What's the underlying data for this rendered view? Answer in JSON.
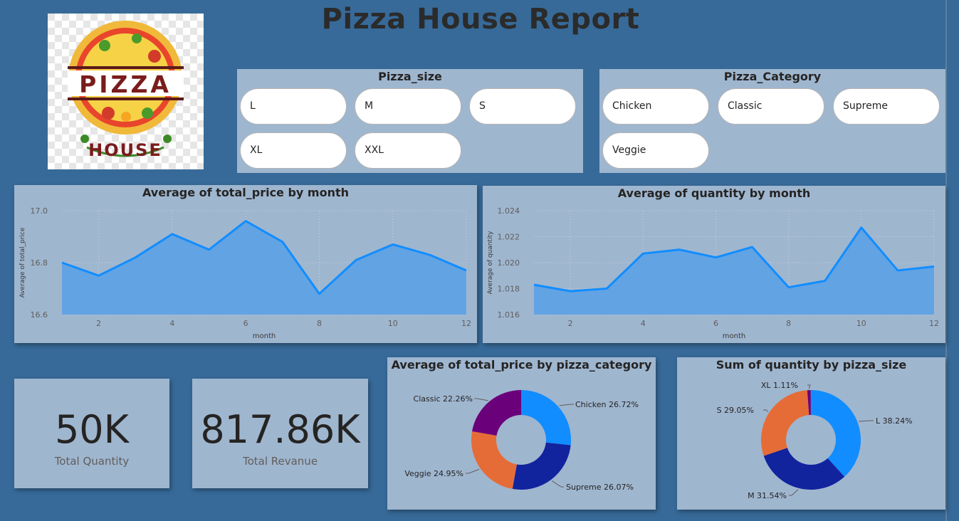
{
  "report": {
    "title": "Pizza House Report"
  },
  "logo": {
    "top_word": "PIZZA",
    "bottom_word": "HOUSE"
  },
  "slicers": {
    "size": {
      "title": "Pizza_size",
      "options": [
        "L",
        "M",
        "S",
        "XL",
        "XXL"
      ]
    },
    "category": {
      "title": "Pizza_Category",
      "options": [
        "Chicken",
        "Classic",
        "Supreme",
        "Veggie"
      ]
    }
  },
  "kpis": {
    "quantity": {
      "value": "50K",
      "label": "Total Quantity"
    },
    "revenue": {
      "value": "817.86K",
      "label": "Total Revanue"
    }
  },
  "colors": {
    "background": "#376a99",
    "panel": "#9fb6cf",
    "line": "#118dff",
    "area": "#62a3e4",
    "pie_blue": "#118dff",
    "pie_navy": "#12239e",
    "pie_orange": "#e66c37",
    "pie_purple": "#6b007b"
  },
  "chart_data": [
    {
      "type": "area",
      "title": "Average of total_price by month",
      "xlabel": "month",
      "ylabel": "Average of total_price",
      "x": [
        1,
        2,
        3,
        4,
        5,
        6,
        7,
        8,
        9,
        10,
        11,
        12
      ],
      "y": [
        16.8,
        16.75,
        16.82,
        16.91,
        16.85,
        16.96,
        16.88,
        16.68,
        16.81,
        16.87,
        16.83,
        16.77
      ],
      "ylim": [
        16.6,
        17.0
      ],
      "yticks": [
        "16.6",
        "16.8",
        "17.0"
      ],
      "xticks": [
        "2",
        "4",
        "6",
        "8",
        "10",
        "12"
      ],
      "grid": true
    },
    {
      "type": "area",
      "title": "Average of quantity by month",
      "xlabel": "month",
      "ylabel": "Average of quantity",
      "x": [
        1,
        2,
        3,
        4,
        5,
        6,
        7,
        8,
        9,
        10,
        11,
        12
      ],
      "y": [
        1.0183,
        1.0178,
        1.018,
        1.0207,
        1.021,
        1.0204,
        1.0212,
        1.0181,
        1.0186,
        1.0227,
        1.0194,
        1.0197
      ],
      "ylim": [
        1.016,
        1.024
      ],
      "yticks": [
        "1.016",
        "1.018",
        "1.020",
        "1.022",
        "1.024"
      ],
      "xticks": [
        "2",
        "4",
        "6",
        "8",
        "10",
        "12"
      ],
      "grid": true
    },
    {
      "type": "pie",
      "title": "Average of total_price by pizza_category",
      "slices": [
        {
          "label": "Chicken",
          "percent": 26.72,
          "text": "Chicken 26.72%",
          "color": "#118dff"
        },
        {
          "label": "Supreme",
          "percent": 26.07,
          "text": "Supreme 26.07%",
          "color": "#12239e"
        },
        {
          "label": "Veggie",
          "percent": 24.95,
          "text": "Veggie 24.95%",
          "color": "#e66c37"
        },
        {
          "label": "Classic",
          "percent": 22.26,
          "text": "Classic 22.26%",
          "color": "#6b007b"
        }
      ]
    },
    {
      "type": "pie",
      "title": "Sum of quantity by pizza_size",
      "slices": [
        {
          "label": "L",
          "percent": 38.24,
          "text": "L 38.24%",
          "color": "#118dff"
        },
        {
          "label": "M",
          "percent": 31.54,
          "text": "M 31.54%",
          "color": "#12239e"
        },
        {
          "label": "S",
          "percent": 29.05,
          "text": "S 29.05%",
          "color": "#e66c37"
        },
        {
          "label": "XL",
          "percent": 1.11,
          "text": "XL 1.11%",
          "color": "#6b007b"
        }
      ]
    }
  ]
}
